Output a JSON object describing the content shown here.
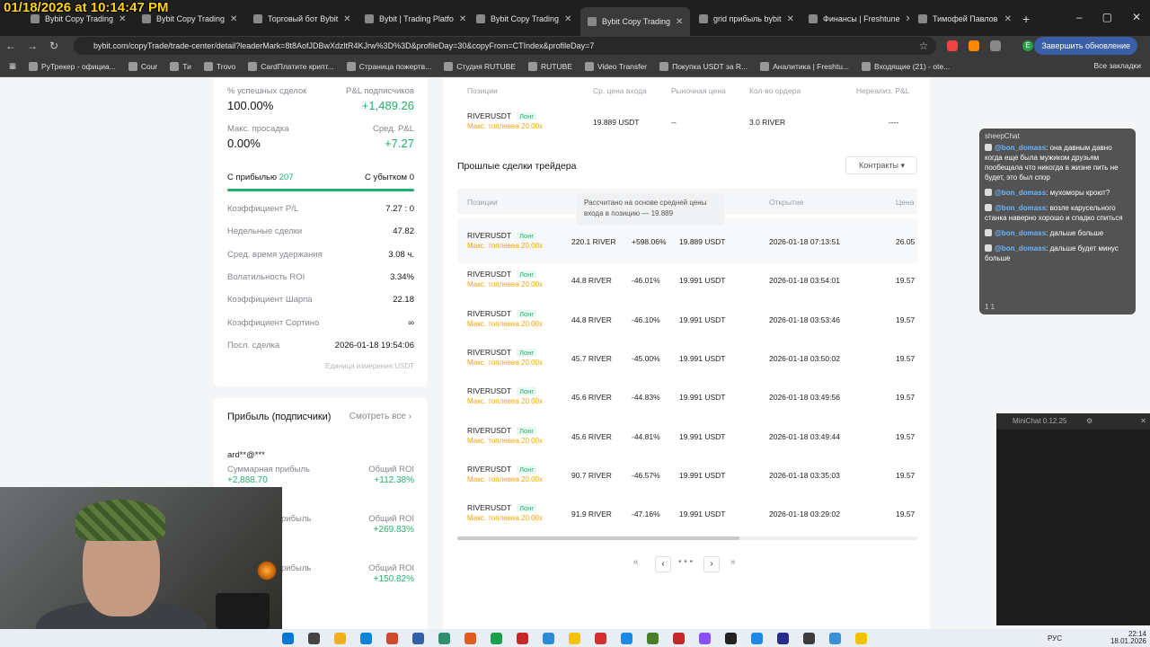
{
  "overlay": {
    "timestamp": "01/18/2026 at 10:14:47 PM"
  },
  "browser": {
    "tabs": [
      {
        "label": "Bybit Copy Trading",
        "active": false
      },
      {
        "label": "Bybit Copy Trading",
        "active": false
      },
      {
        "label": "Торговый бот Bybit",
        "active": false
      },
      {
        "label": "Bybit | Trading Platfo",
        "active": false
      },
      {
        "label": "Bybit Copy Trading",
        "active": false
      },
      {
        "label": "Bybit Copy Trading",
        "active": true
      },
      {
        "label": "grid прибыль bybit",
        "active": false
      },
      {
        "label": "Финансы | Freshtune",
        "active": false
      },
      {
        "label": "Тимофей Павлов",
        "active": false
      }
    ],
    "url": "bybit.com/copyTrade/trade-center/detail?leaderMark=8t8AofJDBwXdzltR4KJrw%3D%3D&profileDay=30&copyFrom=CTIndex&profileDay=7",
    "update_label": "Завершить обновление",
    "profile_letter": "E",
    "bookmarks": [
      "РуТрекер - официа...",
      "Cour",
      "Ти",
      "Trovo",
      "CardПлатите крипт...",
      "Страница пожертв...",
      "Студия RUTUBE",
      "RUTUBE",
      "Video Transfer",
      "Покупка USDT за R...",
      "Аналитика | Freshtu...",
      "Входящие (21) - ote..."
    ],
    "all_bookmarks": "Все закладки"
  },
  "stats": {
    "win_rate_label": "% успешных сделок",
    "win_rate": "100.00%",
    "pnl_subs_label": "P&L подписчиков",
    "pnl_subs": "+1,489.26",
    "max_drawdown_label": "Макс. просадка",
    "max_drawdown": "0.00%",
    "avg_pnl_label": "Сред. P&L",
    "avg_pnl": "+7.27",
    "profit_label": "С прибылью",
    "profit_count": "207",
    "loss_label": "С убытком",
    "loss_count": "0",
    "win_fraction": 1.0,
    "metrics": [
      {
        "k": "Коэффициент P/L",
        "v": "7.27 : 0"
      },
      {
        "k": "Недельные сделки",
        "v": "47.82"
      },
      {
        "k": "Сред. время удержания",
        "v": "3.08 ч."
      },
      {
        "k": "Волатильность ROI",
        "v": "3.34%"
      },
      {
        "k": "Коэффициент Шарпа",
        "v": "22.18"
      },
      {
        "k": "Коэффициент Сортино",
        "v": "∞"
      },
      {
        "k": "Посл. сделка",
        "v": "2026-01-18 19:54:06"
      }
    ],
    "unit_note": "Единица измерения:USDT"
  },
  "subscribers": {
    "title": "Прибыль (подписчики)",
    "see_all": "Смотреть все",
    "user": "ard**@***",
    "sum_label": "Суммарная прибыль",
    "sum_value": "+2,888.70",
    "roi_label": "Общий ROI",
    "rois": [
      "+112.38%",
      "+269.83%",
      "+150.82%"
    ],
    "partial_label": "рибыль"
  },
  "open_positions": {
    "headers": [
      "Позиции",
      "Ср. цена входа",
      "Рыночная цена",
      "Кол-во ордера",
      "Нереализ. P&L"
    ],
    "row": {
      "symbol": "RIVERUSDT",
      "side": "Лонг",
      "leverage": "Макс. топлевеа 20.00x",
      "entry": "19.889 USDT",
      "market": "--",
      "qty": "3.0 RIVER",
      "pnl": "----"
    }
  },
  "past_trades": {
    "title": "Прошлые сделки трейдера",
    "contracts_label": "Контракты",
    "headers": [
      "Позиции",
      "Открытие",
      "Цена"
    ],
    "tooltip": "Рассчитано на основе средней цены входа в позицию — 19.889",
    "rows": [
      {
        "symbol": "RIVERUSDT",
        "side": "Лонг",
        "leverage": "Макс. топлевеа 20.00x",
        "qty": "220.1 RIVER",
        "roi": "+598.06%",
        "entry": "19.889 USDT",
        "opened": "2026-01-18 07:13:51",
        "price": "26.05"
      },
      {
        "symbol": "RIVERUSDT",
        "side": "Лонг",
        "leverage": "Макс. топлевеа 20.00x",
        "qty": "44.8 RIVER",
        "roi": "-46.01%",
        "entry": "19.991 USDT",
        "opened": "2026-01-18 03:54:01",
        "price": "19.57"
      },
      {
        "symbol": "RIVERUSDT",
        "side": "Лонг",
        "leverage": "Макс. топлевеа 20.00x",
        "qty": "44.8 RIVER",
        "roi": "-46.10%",
        "entry": "19.991 USDT",
        "opened": "2026-01-18 03:53:46",
        "price": "19.57"
      },
      {
        "symbol": "RIVERUSDT",
        "side": "Лонг",
        "leverage": "Макс. топлевеа 20.00x",
        "qty": "45.7 RIVER",
        "roi": "-45.00%",
        "entry": "19.991 USDT",
        "opened": "2026-01-18 03:50:02",
        "price": "19.57"
      },
      {
        "symbol": "RIVERUSDT",
        "side": "Лонг",
        "leverage": "Макс. топлевеа 20.00x",
        "qty": "45.6 RIVER",
        "roi": "-44.83%",
        "entry": "19.991 USDT",
        "opened": "2026-01-18 03:49:56",
        "price": "19.57"
      },
      {
        "symbol": "RIVERUSDT",
        "side": "Лонг",
        "leverage": "Макс. топлевеа 20.00x",
        "qty": "45.6 RIVER",
        "roi": "-44.81%",
        "entry": "19.991 USDT",
        "opened": "2026-01-18 03:49:44",
        "price": "19.57"
      },
      {
        "symbol": "RIVERUSDT",
        "side": "Лонг",
        "leverage": "Макс. топлевеа 20.00x",
        "qty": "90.7 RIVER",
        "roi": "-46.57%",
        "entry": "19.991 USDT",
        "opened": "2026-01-18 03:35:03",
        "price": "19.57"
      },
      {
        "symbol": "RIVERUSDT",
        "side": "Лонг",
        "leverage": "Макс. топлевеа 20.00x",
        "qty": "91.9 RIVER",
        "roi": "-47.16%",
        "entry": "19.991 USDT",
        "opened": "2026-01-18 03:29:02",
        "price": "19.57"
      }
    ],
    "pager": {
      "first": "«",
      "prev": "‹",
      "dots": "• • •",
      "next": "›",
      "last": "»"
    }
  },
  "chat": {
    "title": "sheepChat",
    "messages": [
      {
        "user": "@bon_domass",
        "text": "она давным давно когда еще была мужиком друзьям пообещала что никогда в жизне пить не будет, это был спор"
      },
      {
        "user": "@bon_domass",
        "text": "мухоморы кроют?"
      },
      {
        "user": "@bon_domass",
        "text": "возле карусельного станка наверно хорошо и спадко спиться"
      },
      {
        "user": "@bon_domass",
        "text": "дальше больше"
      },
      {
        "user": "@bon_domass",
        "text": "дальше будет минус больше"
      }
    ],
    "footer": "1   1"
  },
  "minichat": {
    "title": "MiniChat 0.12.25"
  },
  "taskbar": {
    "lang": "РУС",
    "time": "22:14",
    "date": "18.01.2026"
  },
  "colors": {
    "green": "#20b26c",
    "red": "#ef454a",
    "orange": "#f7a600"
  }
}
